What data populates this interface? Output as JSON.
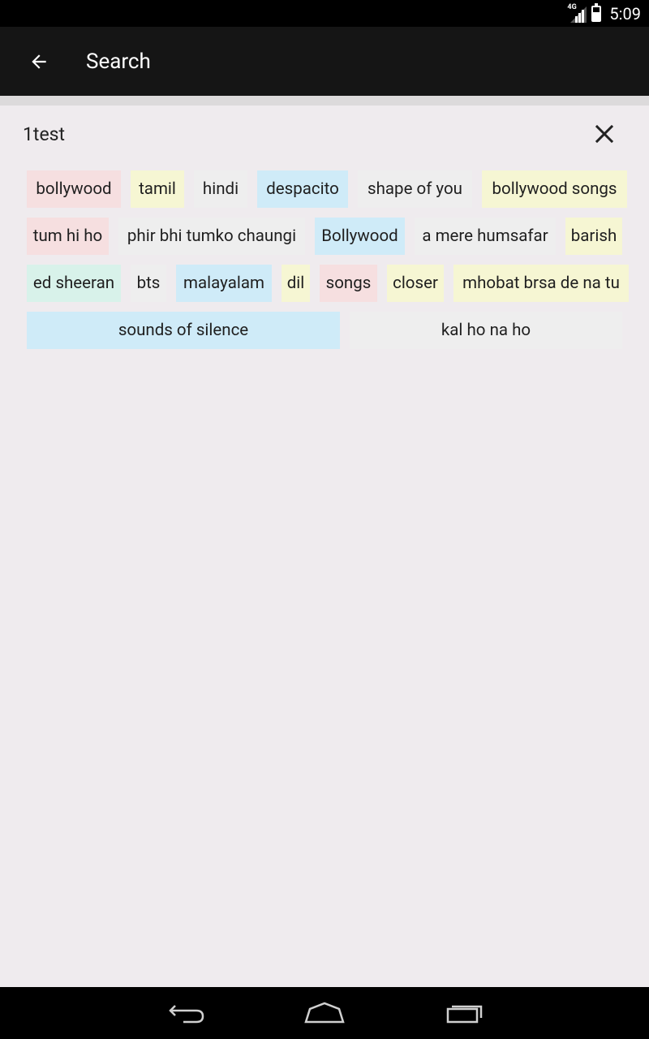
{
  "status_bar": {
    "time": "5:09",
    "network_label": "4G"
  },
  "app_bar": {
    "title": "Search"
  },
  "search": {
    "value": "1test"
  },
  "chip_rows": [
    [
      {
        "label": "bollywood",
        "color": "pink"
      },
      {
        "label": "tamil",
        "color": "yellow"
      },
      {
        "label": "hindi",
        "color": "gray"
      },
      {
        "label": "despacito",
        "color": "blue"
      },
      {
        "label": "shape of you",
        "color": "gray"
      },
      {
        "label": "bollywood songs",
        "color": "yellow"
      }
    ],
    [
      {
        "label": "tum hi ho",
        "color": "pink"
      },
      {
        "label": "phir bhi tumko chaungi",
        "color": "gray"
      },
      {
        "label": "Bollywood",
        "color": "blue"
      },
      {
        "label": "a mere humsafar",
        "color": "gray"
      },
      {
        "label": "barish",
        "color": "yellow"
      }
    ],
    [
      {
        "label": "ed sheeran",
        "color": "mint"
      },
      {
        "label": "bts",
        "color": "gray"
      },
      {
        "label": "malayalam",
        "color": "blue"
      },
      {
        "label": "dil",
        "color": "yellow"
      },
      {
        "label": "songs",
        "color": "pink"
      },
      {
        "label": "closer",
        "color": "yellow"
      },
      {
        "label": "mhobat brsa de na tu",
        "color": "yellow"
      }
    ],
    [
      {
        "label": "sounds of silence",
        "color": "blue"
      },
      {
        "label": "kal ho na ho",
        "color": "gray"
      }
    ]
  ],
  "colors": {
    "pink": "#f6dfe0",
    "yellow": "#f6f6d3",
    "gray": "#eeeeee",
    "blue": "#cfebf8",
    "mint": "#d8f2ea"
  },
  "icons": {
    "back": "arrow-back-icon",
    "clear": "close-icon",
    "nav_back": "nav-back-icon",
    "nav_home": "nav-home-icon",
    "nav_recents": "nav-recents-icon"
  }
}
